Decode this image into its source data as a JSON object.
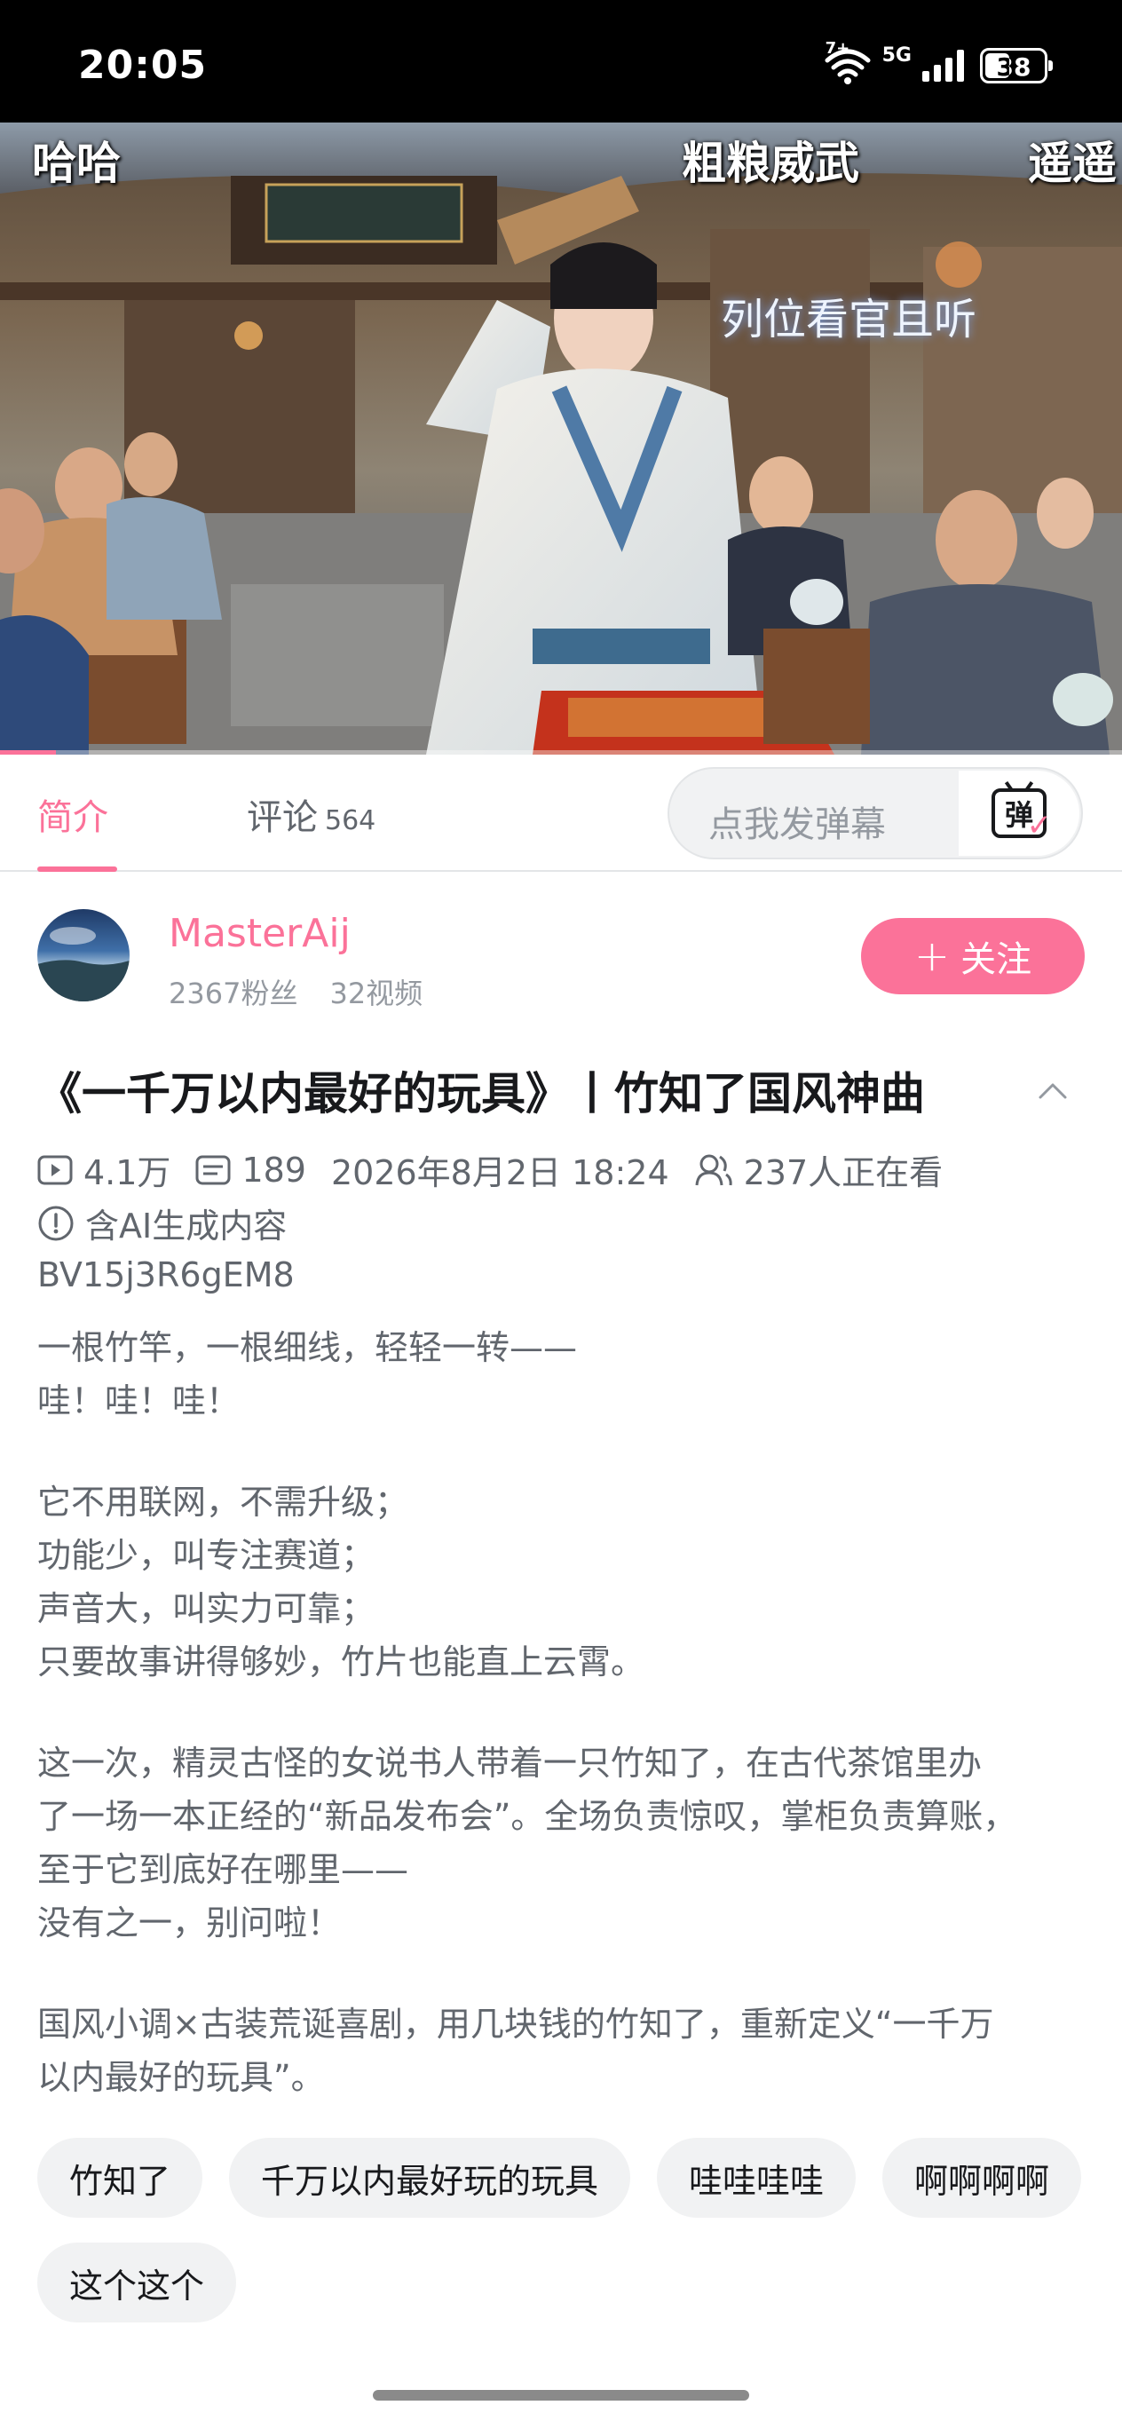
{
  "status_bar": {
    "time": "20:05",
    "wifi_sup": "7+",
    "network": "5G",
    "battery": "38"
  },
  "video": {
    "danmaku": [
      "哈哈",
      "粗粮威武",
      "遥遥"
    ],
    "caption": "列位看官且听",
    "progress_fraction": 0.05
  },
  "tabs": {
    "intro": "简介",
    "comments": "评论",
    "comments_count": "564",
    "danmaku_placeholder": "点我发弹幕",
    "danmaku_icon_char": "弹"
  },
  "uploader": {
    "name": "MasterAij",
    "fans": "2367粉丝",
    "videos": "32视频",
    "follow_label": "关注",
    "follow_plus": "+"
  },
  "video_info": {
    "title": "《一千万以内最好的玩具》丨竹知了国风神曲",
    "views": "4.1万",
    "danmaku_count": "189",
    "publish_time": "2026年8月2日 18:24",
    "watching": "237人正在看",
    "ai_note": "含AI生成内容",
    "bvid": "BV15j3R6gEM8"
  },
  "description": {
    "lines": [
      "一根竹竿，一根细线，轻轻一转——",
      "哇！哇！哇！",
      "",
      "它不用联网，不需升级；",
      "功能少，叫专注赛道；",
      "声音大，叫实力可靠；",
      "只要故事讲得够妙，竹片也能直上云霄。",
      "",
      "这一次，精灵古怪的女说书人带着一只竹知了，在古代茶馆里办",
      "了一场一本正经的“新品发布会”。全场负责惊叹，掌柜负责算账，",
      "至于它到底好在哪里——",
      "没有之一，别问啦！",
      "",
      "国风小调×古装荒诞喜剧，用几块钱的竹知了，重新定义“一千万",
      "以内最好的玩具”。"
    ]
  },
  "tags": [
    "竹知了",
    "千万以内最好玩的玩具",
    "哇哇哇哇",
    "啊啊啊啊",
    "这个这个"
  ],
  "icons": {
    "play": "play-count-icon",
    "danmaku": "danmaku-count-icon",
    "watching": "watching-people-icon",
    "ai": "info-circle-icon",
    "collapse": "chevron-up-icon"
  },
  "colors": {
    "accent": "#fb7299",
    "text": "#18191c",
    "secondary": "#61666d",
    "muted": "#9499a0"
  }
}
